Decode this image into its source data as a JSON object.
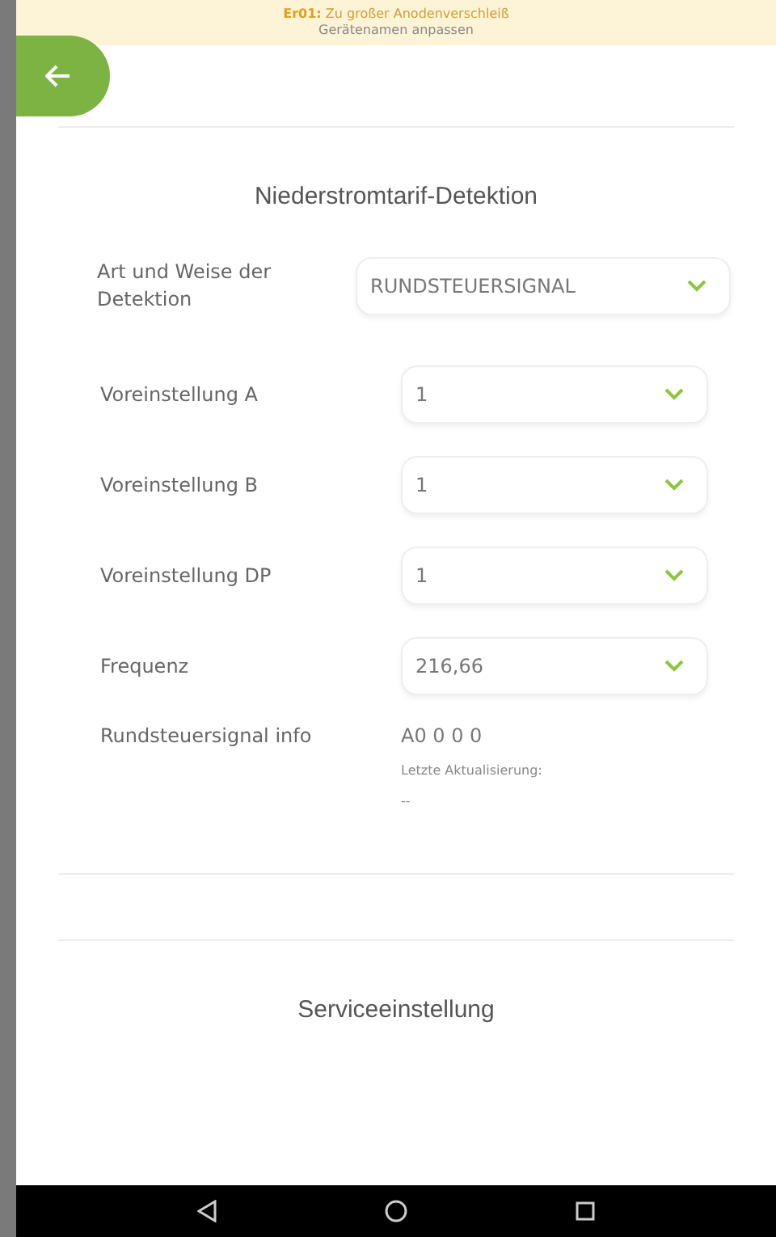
{
  "banner": {
    "error_code": "Er01:",
    "error_text": "Zu großer Anodenverschleiß",
    "link": "Gerätenamen anpassen"
  },
  "section": {
    "title": "Niederstromtarif-Detektion",
    "detection": {
      "label": "Art und Weise der Detektion",
      "value": "RUNDSTEUERSIGNAL"
    },
    "settings": [
      {
        "label": "Voreinstellung A",
        "value": "1"
      },
      {
        "label": "Voreinstellung B",
        "value": "1"
      },
      {
        "label": "Voreinstellung DP",
        "value": "1"
      },
      {
        "label": "Frequenz",
        "value": "216,66"
      }
    ],
    "info": {
      "label": "Rundsteuersignal info",
      "value": "A0 0 0 0",
      "update_label": "Letzte Aktualisierung:",
      "update_value": "--"
    }
  },
  "section2": {
    "title": "Serviceeinstellung"
  }
}
